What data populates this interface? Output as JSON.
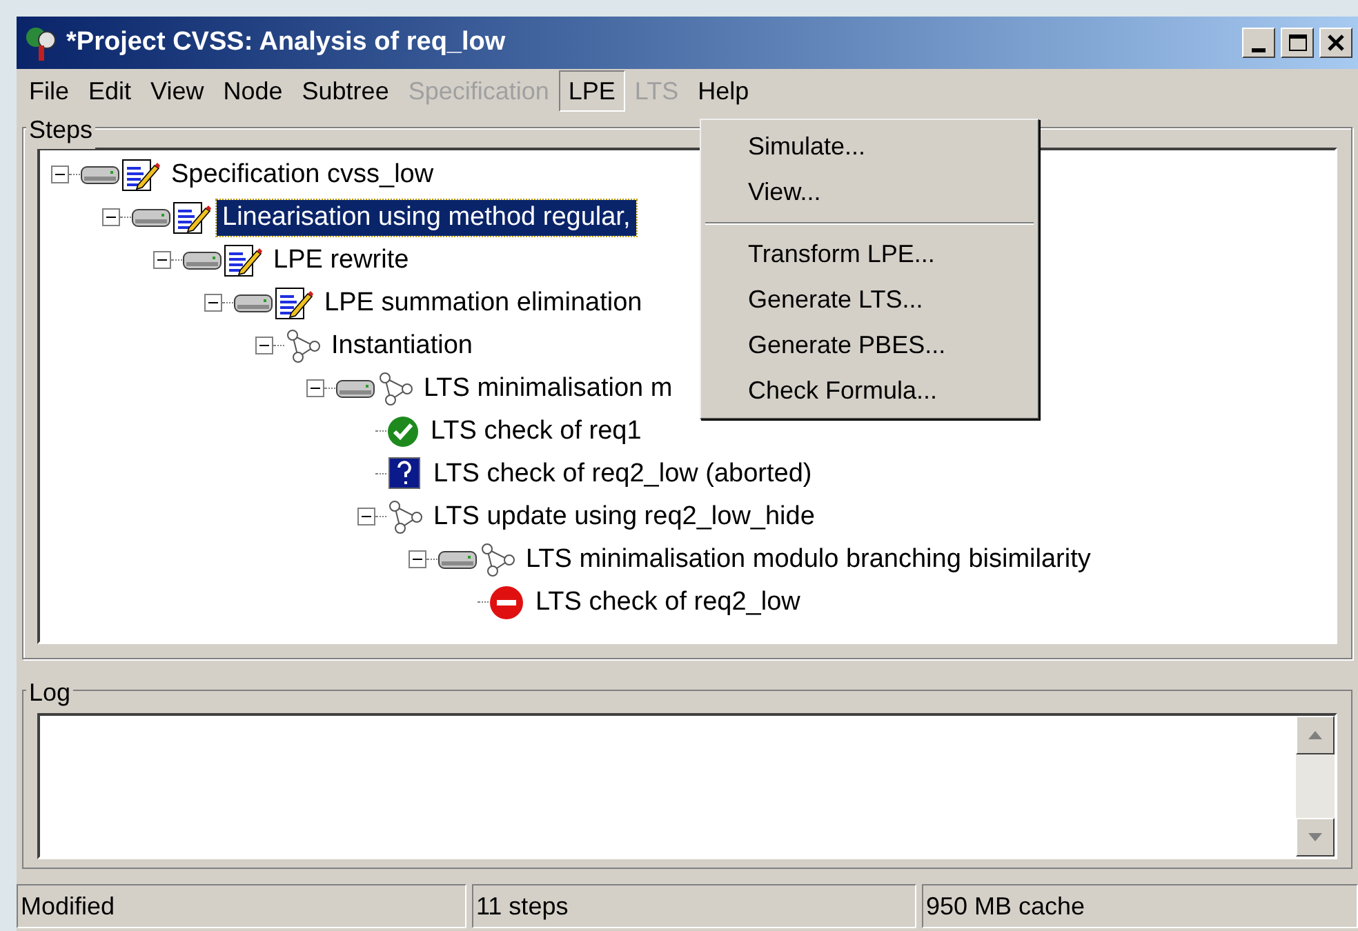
{
  "window": {
    "title": "*Project CVSS: Analysis of req_low"
  },
  "menu": [
    {
      "label": "File",
      "disabled": false,
      "selected": false
    },
    {
      "label": "Edit",
      "disabled": false,
      "selected": false
    },
    {
      "label": "View",
      "disabled": false,
      "selected": false
    },
    {
      "label": "Node",
      "disabled": false,
      "selected": false
    },
    {
      "label": "Subtree",
      "disabled": false,
      "selected": false
    },
    {
      "label": "Specification",
      "disabled": true,
      "selected": false
    },
    {
      "label": "LPE",
      "disabled": false,
      "selected": true
    },
    {
      "label": "LTS",
      "disabled": true,
      "selected": false
    },
    {
      "label": "Help",
      "disabled": false,
      "selected": false
    }
  ],
  "dropdown": [
    {
      "kind": "item",
      "label": "Simulate..."
    },
    {
      "kind": "item",
      "label": "View..."
    },
    {
      "kind": "separator"
    },
    {
      "kind": "item",
      "label": "Transform LPE..."
    },
    {
      "kind": "item",
      "label": "Generate LTS..."
    },
    {
      "kind": "item",
      "label": "Generate PBES..."
    },
    {
      "kind": "item",
      "label": "Check Formula..."
    }
  ],
  "steps": {
    "title": "Steps",
    "tree": [
      {
        "label": "Specification cvss_low",
        "kind": "spec",
        "expanded": true,
        "selected": false,
        "children": [
          {
            "label": "Linearisation using method regular,",
            "kind": "spec",
            "expanded": true,
            "selected": true,
            "children": [
              {
                "label": "LPE rewrite",
                "kind": "spec",
                "expanded": true,
                "selected": false,
                "children": [
                  {
                    "label": "LPE summation elimination",
                    "kind": "spec",
                    "expanded": true,
                    "selected": false,
                    "children": [
                      {
                        "label": "Instantiation",
                        "kind": "graph",
                        "expanded": true,
                        "selected": false,
                        "children": [
                          {
                            "label": "LTS minimalisation m",
                            "kind": "stored-graph",
                            "expanded": true,
                            "selected": false,
                            "children": [
                              {
                                "label": "LTS check of req1",
                                "kind": "ok",
                                "selected": false
                              },
                              {
                                "label": "LTS check of req2_low (aborted)",
                                "kind": "unknown",
                                "selected": false
                              },
                              {
                                "label": "LTS update using req2_low_hide",
                                "kind": "graph",
                                "expanded": true,
                                "selected": false,
                                "children": [
                                  {
                                    "label": "LTS minimalisation modulo branching bisimilarity",
                                    "kind": "stored-graph",
                                    "expanded": true,
                                    "selected": false,
                                    "children": [
                                      {
                                        "label": "LTS check of req2_low",
                                        "kind": "error",
                                        "selected": false
                                      }
                                    ]
                                  }
                                ]
                              }
                            ]
                          }
                        ]
                      }
                    ]
                  }
                ]
              }
            ]
          }
        ]
      }
    ]
  },
  "log": {
    "title": "Log"
  },
  "status_bar": [
    "Modified",
    "11 steps",
    "950 MB cache"
  ]
}
